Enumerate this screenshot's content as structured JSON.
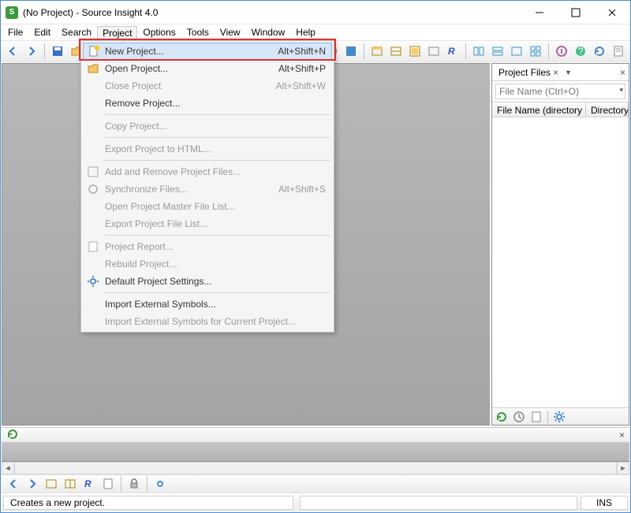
{
  "window": {
    "title": "(No Project) - Source Insight 4.0"
  },
  "menubar": [
    "File",
    "Edit",
    "Search",
    "Project",
    "Options",
    "Tools",
    "View",
    "Window",
    "Help"
  ],
  "project_menu": {
    "items": [
      {
        "label": "New Project...",
        "shortcut": "Alt+Shift+N",
        "enabled": true,
        "highlight": true,
        "icon": "new"
      },
      {
        "label": "Open Project...",
        "shortcut": "Alt+Shift+P",
        "enabled": true,
        "icon": "open"
      },
      {
        "label": "Close Project",
        "shortcut": "Alt+Shift+W",
        "enabled": false
      },
      {
        "label": "Remove Project...",
        "shortcut": "",
        "enabled": true
      },
      {
        "sep": true
      },
      {
        "label": "Copy Project...",
        "shortcut": "",
        "enabled": false
      },
      {
        "sep": true
      },
      {
        "label": "Export Project to HTML...",
        "shortcut": "",
        "enabled": false
      },
      {
        "sep": true
      },
      {
        "label": "Add and Remove Project Files...",
        "shortcut": "",
        "enabled": false,
        "icon": "addremove"
      },
      {
        "label": "Synchronize Files...",
        "shortcut": "Alt+Shift+S",
        "enabled": false,
        "icon": "sync"
      },
      {
        "label": "Open Project Master File List...",
        "shortcut": "",
        "enabled": false
      },
      {
        "label": "Export Project File List...",
        "shortcut": "",
        "enabled": false
      },
      {
        "sep": true
      },
      {
        "label": "Project Report...",
        "shortcut": "",
        "enabled": false,
        "icon": "report"
      },
      {
        "label": "Rebuild Project...",
        "shortcut": "",
        "enabled": false
      },
      {
        "label": "Default Project Settings...",
        "shortcut": "",
        "enabled": true,
        "icon": "gear"
      },
      {
        "sep": true
      },
      {
        "label": "Import External Symbols...",
        "shortcut": "",
        "enabled": true
      },
      {
        "label": "Import External Symbols for Current Project...",
        "shortcut": "",
        "enabled": false
      }
    ]
  },
  "sidepanel": {
    "tab_label": "Project Files",
    "filter_placeholder": "File Name (Ctrl+O)",
    "col1": "File Name (directory order)",
    "col2": "Directory"
  },
  "statusbar": {
    "hint": "Creates a new project.",
    "mode": "INS"
  },
  "dock": {
    "tab_icon": "reload",
    "close": "×"
  }
}
